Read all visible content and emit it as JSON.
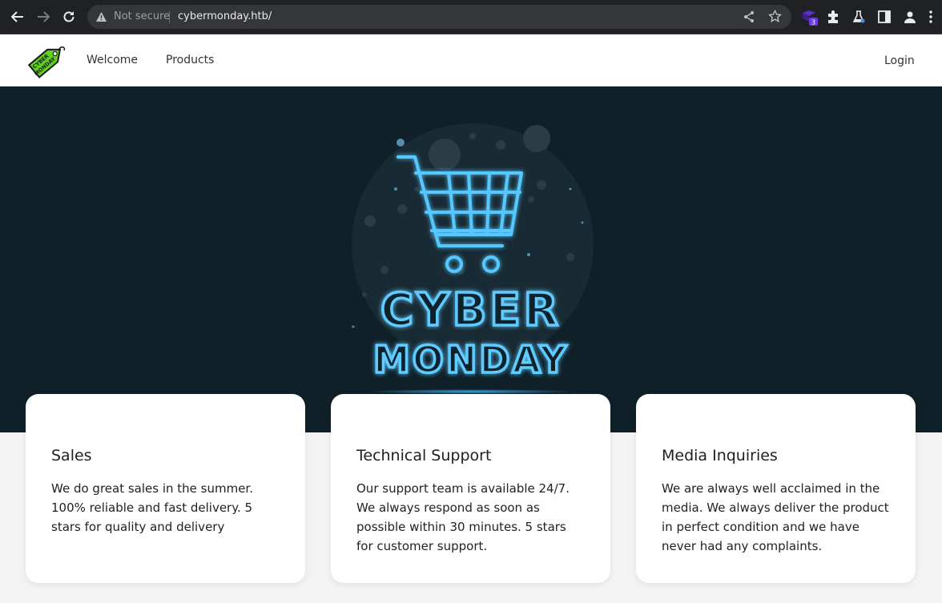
{
  "browser": {
    "security_label": "Not secure",
    "url": "cybermonday.htb/",
    "extension_badge": "3"
  },
  "header": {
    "logo_text": "CYBER MONDAY",
    "nav": [
      {
        "label": "Welcome"
      },
      {
        "label": "Products"
      }
    ],
    "login_label": "Login"
  },
  "hero": {
    "line1": "CYBER",
    "line2": "MONDAY"
  },
  "cards": [
    {
      "title": "Sales",
      "text": "We do great sales in the summer. 100% reliable and fast delivery. 5 stars for quality and delivery"
    },
    {
      "title": "Technical Support",
      "text": "Our support team is available 24/7. We always respond as soon as possible within 30 minutes. 5 stars for customer support."
    },
    {
      "title": "Media Inquiries",
      "text": "We are always well acclaimed in the media. We always deliver the product in perfect condition and we have never had any complaints."
    }
  ]
}
